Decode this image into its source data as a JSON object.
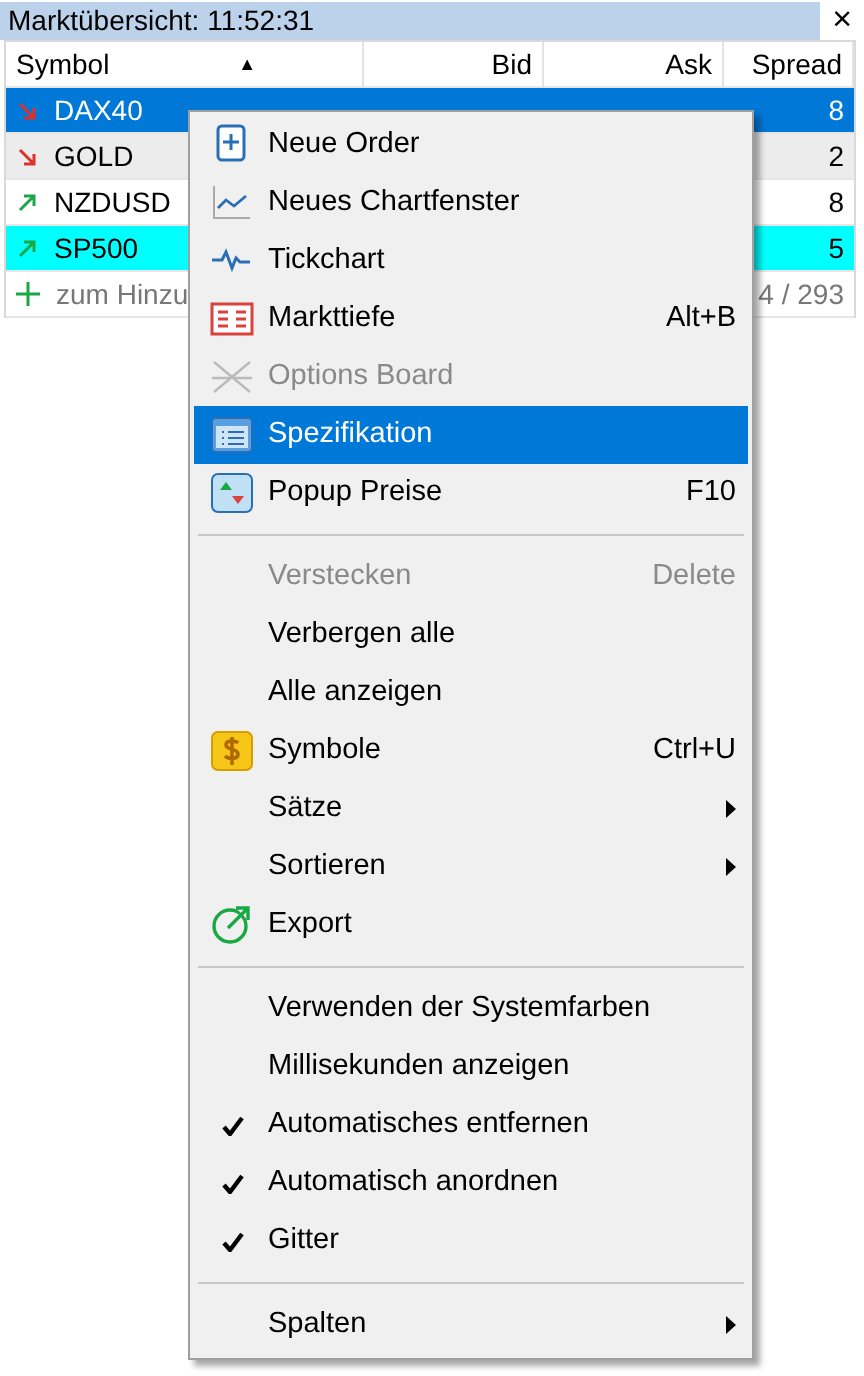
{
  "window": {
    "title": "Marktübersicht: 11:52:31",
    "close": "×"
  },
  "table": {
    "columns": [
      "Symbol",
      "Bid",
      "Ask",
      "Spread"
    ],
    "sorted_column_marker": "▲",
    "rows": [
      {
        "symbol": "DAX40",
        "kind": "down",
        "spread": "8",
        "selected": true,
        "highlight": false
      },
      {
        "symbol": "GOLD",
        "kind": "down",
        "spread": "2",
        "selected": false,
        "highlight": false
      },
      {
        "symbol": "NZDUSD",
        "kind": "up",
        "spread": "8",
        "selected": false,
        "highlight": false
      },
      {
        "symbol": "SP500",
        "kind": "up",
        "spread": "5",
        "selected": false,
        "highlight": true
      }
    ],
    "add_row": {
      "label": "zum Hinzu",
      "count": "4 / 293"
    }
  },
  "context_menu": {
    "items": [
      {
        "kind": "item",
        "label": "Neue Order",
        "disabled": false,
        "selected": false,
        "checked": false
      },
      {
        "kind": "item",
        "label": "Neues Chartfenster",
        "disabled": false,
        "selected": false,
        "checked": false
      },
      {
        "kind": "item",
        "label": "Tickchart",
        "disabled": false,
        "selected": false,
        "checked": false
      },
      {
        "kind": "item",
        "label": "Markttiefe",
        "shortcut": "Alt+B",
        "disabled": false,
        "selected": false,
        "checked": false
      },
      {
        "kind": "item",
        "label": "Options Board",
        "disabled": true,
        "selected": false,
        "checked": false
      },
      {
        "kind": "item",
        "label": "Spezifikation",
        "disabled": false,
        "selected": true,
        "checked": false
      },
      {
        "kind": "item",
        "label": "Popup Preise",
        "shortcut": "F10",
        "disabled": false,
        "selected": false,
        "checked": false
      },
      {
        "kind": "separator"
      },
      {
        "kind": "item",
        "label": "Verstecken",
        "shortcut": "Delete",
        "disabled": true,
        "selected": false,
        "checked": false
      },
      {
        "kind": "item",
        "label": "Verbergen alle",
        "disabled": false,
        "selected": false,
        "checked": false
      },
      {
        "kind": "item",
        "label": "Alle anzeigen",
        "disabled": false,
        "selected": false,
        "checked": false
      },
      {
        "kind": "item",
        "label": "Symbole",
        "shortcut": "Ctrl+U",
        "disabled": false,
        "selected": false,
        "checked": false
      },
      {
        "kind": "item",
        "label": "Sätze",
        "submenu": true,
        "disabled": false,
        "selected": false,
        "checked": false
      },
      {
        "kind": "item",
        "label": "Sortieren",
        "submenu": true,
        "disabled": false,
        "selected": false,
        "checked": false
      },
      {
        "kind": "item",
        "label": "Export",
        "disabled": false,
        "selected": false,
        "checked": false
      },
      {
        "kind": "separator"
      },
      {
        "kind": "item",
        "label": "Verwenden der Systemfarben",
        "disabled": false,
        "selected": false,
        "checked": false
      },
      {
        "kind": "item",
        "label": "Millisekunden anzeigen",
        "disabled": false,
        "selected": false,
        "checked": false
      },
      {
        "kind": "item",
        "label": "Automatisches entfernen",
        "disabled": false,
        "selected": false,
        "checked": true
      },
      {
        "kind": "item",
        "label": "Automatisch anordnen",
        "disabled": false,
        "selected": false,
        "checked": true
      },
      {
        "kind": "item",
        "label": "Gitter",
        "disabled": false,
        "selected": false,
        "checked": true
      },
      {
        "kind": "separator"
      },
      {
        "kind": "item",
        "label": "Spalten",
        "submenu": true,
        "disabled": false,
        "selected": false,
        "checked": false
      }
    ]
  }
}
